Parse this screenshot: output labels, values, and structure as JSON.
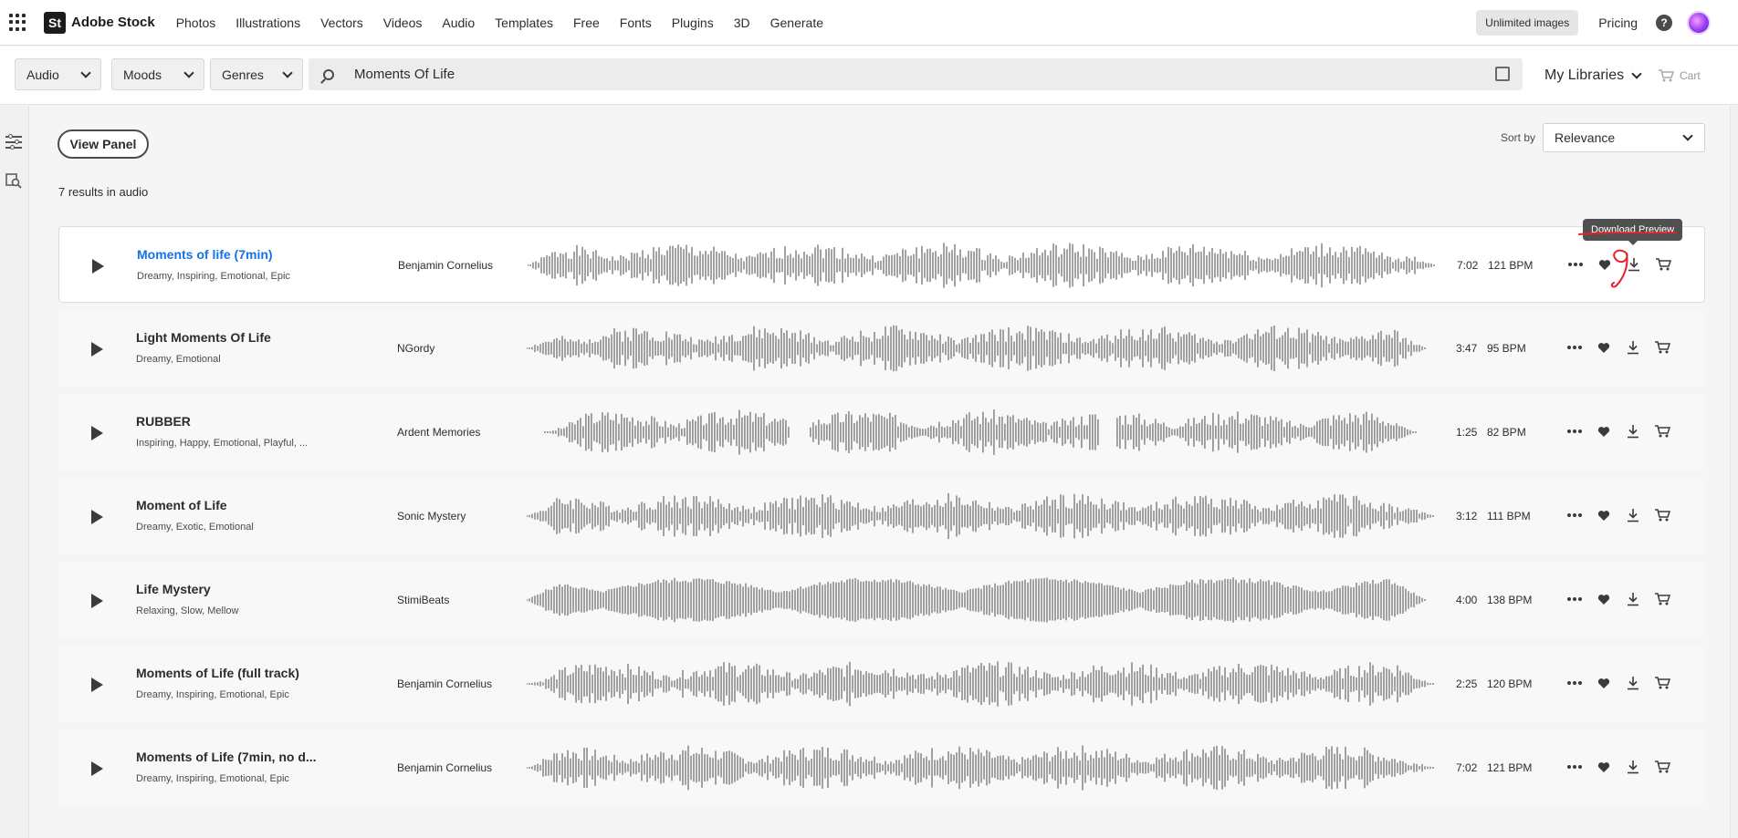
{
  "nav": {
    "logo_mark": "St",
    "logo_text": "Adobe Stock",
    "menu": [
      "Photos",
      "Illustrations",
      "Vectors",
      "Videos",
      "Audio",
      "Templates",
      "Free",
      "Fonts",
      "Plugins",
      "3D",
      "Generate"
    ],
    "unlimited_label": "Unlimited images",
    "pricing_label": "Pricing",
    "help_glyph": "?"
  },
  "search": {
    "asset_type": "Audio",
    "moods": "Moods",
    "genres": "Genres",
    "query": "Moments Of Life",
    "libraries_label": "My Libraries",
    "cart_label": "Cart"
  },
  "content": {
    "view_panel_label": "View Panel",
    "results_text": "7 results in audio",
    "sort_label": "Sort by",
    "sort_value": "Relevance",
    "tooltip": "Download Preview"
  },
  "tracks": [
    {
      "title": "Moments of life (7min)",
      "tags": "Dreamy, Inspiring, Emotional, Epic",
      "artist": "Benjamin Cornelius",
      "duration": "7:02",
      "bpm": "121 BPM"
    },
    {
      "title": "Light Moments Of Life",
      "tags": "Dreamy, Emotional",
      "artist": "NGordy",
      "duration": "3:47",
      "bpm": "95 BPM"
    },
    {
      "title": "RUBBER",
      "tags": "Inspiring, Happy, Emotional, Playful, ...",
      "artist": "Ardent Memories",
      "duration": "1:25",
      "bpm": "82 BPM"
    },
    {
      "title": "Moment of Life",
      "tags": "Dreamy, Exotic, Emotional",
      "artist": "Sonic Mystery",
      "duration": "3:12",
      "bpm": "111 BPM"
    },
    {
      "title": "Life Mystery",
      "tags": "Relaxing, Slow, Mellow",
      "artist": "StimiBeats",
      "duration": "4:00",
      "bpm": "138 BPM"
    },
    {
      "title": "Moments of Life (full track)",
      "tags": "Dreamy, Inspiring, Emotional, Epic",
      "artist": "Benjamin Cornelius",
      "duration": "2:25",
      "bpm": "120 BPM"
    },
    {
      "title": "Moments of Life (7min, no d...",
      "tags": "Dreamy, Inspiring, Emotional, Epic",
      "artist": "Benjamin Cornelius",
      "duration": "7:02",
      "bpm": "121 BPM"
    }
  ],
  "colors": {
    "link": "#1473e6",
    "wave": "#8c8c8c",
    "annotation": "#e8202a"
  },
  "icons": [
    "apps-grid-icon",
    "search-icon",
    "visual-search-icon",
    "chevron-down-icon",
    "cart-icon",
    "filter-icon",
    "image-search-icon",
    "play-icon",
    "more-icon",
    "heart-icon",
    "download-icon"
  ]
}
